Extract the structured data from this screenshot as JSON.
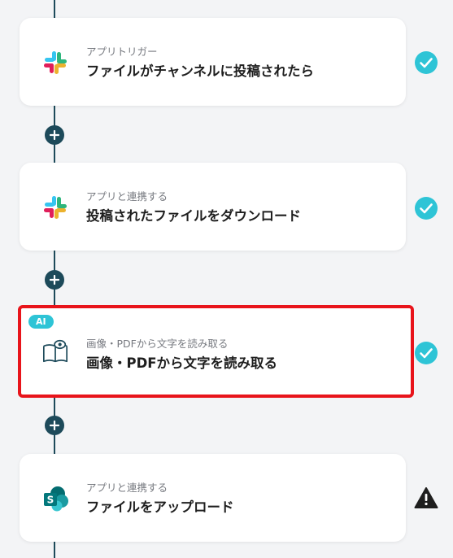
{
  "steps": [
    {
      "subtitle": "アプリトリガー",
      "title": "ファイルがチャンネルに投稿されたら",
      "app_icon": "slack-icon",
      "status": "check-icon"
    },
    {
      "subtitle": "アプリと連携する",
      "title": "投稿されたファイルをダウンロード",
      "app_icon": "slack-icon",
      "status": "check-icon"
    },
    {
      "subtitle": "画像・PDFから文字を読み取る",
      "title": "画像・PDFから文字を読み取る",
      "app_icon": "book-eye-icon",
      "badge": "AI",
      "status": "check-icon",
      "selected": true
    },
    {
      "subtitle": "アプリと連携する",
      "title": "ファイルをアップロード",
      "app_icon": "sharepoint-icon",
      "status": "warning-icon"
    }
  ],
  "add_button_icon": "plus-icon",
  "colors": {
    "accent": "#2ec4d6",
    "flow_line": "#1d4a5a",
    "selection": "#e8141b",
    "warning": "#1e1e1e"
  }
}
